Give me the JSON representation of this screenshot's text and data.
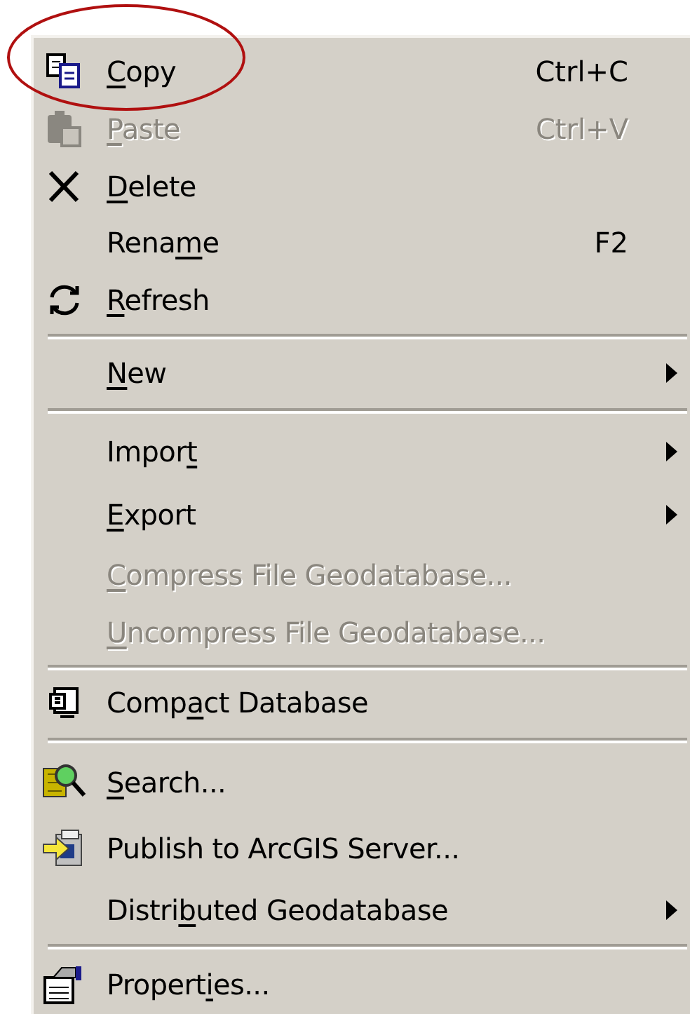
{
  "annotations": [
    {
      "kind": "ellipse"
    }
  ],
  "menu": {
    "items": [
      {
        "kind": "item",
        "label": [
          {
            "text": "C",
            "underlined": true
          },
          {
            "text": "opy",
            "underlined": false
          }
        ],
        "shortcut": "Ctrl+C",
        "disabled": false,
        "submenu": false
      },
      {
        "kind": "item",
        "label": [
          {
            "text": "P",
            "underlined": true
          },
          {
            "text": "aste",
            "underlined": false
          }
        ],
        "shortcut": "Ctrl+V",
        "disabled": true,
        "submenu": false
      },
      {
        "kind": "item",
        "label": [
          {
            "text": "D",
            "underlined": true
          },
          {
            "text": "elete",
            "underlined": false
          }
        ],
        "disabled": false,
        "submenu": false
      },
      {
        "kind": "item",
        "label": [
          {
            "text": "Rena",
            "underlined": false
          },
          {
            "text": "m",
            "underlined": true
          },
          {
            "text": "e",
            "underlined": false
          }
        ],
        "shortcut": "F2",
        "disabled": false,
        "submenu": false
      },
      {
        "kind": "item",
        "label": [
          {
            "text": "R",
            "underlined": true
          },
          {
            "text": "efresh",
            "underlined": false
          }
        ],
        "disabled": false,
        "submenu": false
      },
      {
        "kind": "separator"
      },
      {
        "kind": "item",
        "label": [
          {
            "text": "N",
            "underlined": true
          },
          {
            "text": "ew",
            "underlined": false
          }
        ],
        "disabled": false,
        "submenu": true
      },
      {
        "kind": "separator"
      },
      {
        "kind": "item",
        "label": [
          {
            "text": "Impor",
            "underlined": false
          },
          {
            "text": "t",
            "underlined": true
          }
        ],
        "disabled": false,
        "submenu": true
      },
      {
        "kind": "item",
        "label": [
          {
            "text": "E",
            "underlined": true
          },
          {
            "text": "xport",
            "underlined": false
          }
        ],
        "disabled": false,
        "submenu": true
      },
      {
        "kind": "item",
        "label": [
          {
            "text": "C",
            "underlined": true
          },
          {
            "text": "ompress File Geodatabase...",
            "underlined": false
          }
        ],
        "disabled": true,
        "submenu": false
      },
      {
        "kind": "item",
        "label": [
          {
            "text": "U",
            "underlined": true
          },
          {
            "text": "ncompress File Geodatabase...",
            "underlined": false
          }
        ],
        "disabled": true,
        "submenu": false
      },
      {
        "kind": "separator"
      },
      {
        "kind": "item",
        "label": [
          {
            "text": "Comp",
            "underlined": false
          },
          {
            "text": "a",
            "underlined": true
          },
          {
            "text": "ct Database",
            "underlined": false
          }
        ],
        "disabled": false,
        "submenu": false
      },
      {
        "kind": "separator"
      },
      {
        "kind": "item",
        "label": [
          {
            "text": "S",
            "underlined": true
          },
          {
            "text": "earch...",
            "underlined": false
          }
        ],
        "disabled": false,
        "submenu": false
      },
      {
        "kind": "item",
        "label": [
          {
            "text": "Publish to ArcGIS Server...",
            "underlined": false
          }
        ],
        "disabled": false,
        "submenu": false
      },
      {
        "kind": "item",
        "label": [
          {
            "text": "Distri",
            "underlined": false
          },
          {
            "text": "b",
            "underlined": true
          },
          {
            "text": "uted Geodatabase",
            "underlined": false
          }
        ],
        "disabled": false,
        "submenu": true
      },
      {
        "kind": "separator"
      },
      {
        "kind": "item",
        "label": [
          {
            "text": "Propert",
            "underlined": false
          },
          {
            "text": "i",
            "underlined": true
          },
          {
            "text": "es...",
            "underlined": false
          }
        ],
        "disabled": false,
        "submenu": false
      }
    ]
  }
}
